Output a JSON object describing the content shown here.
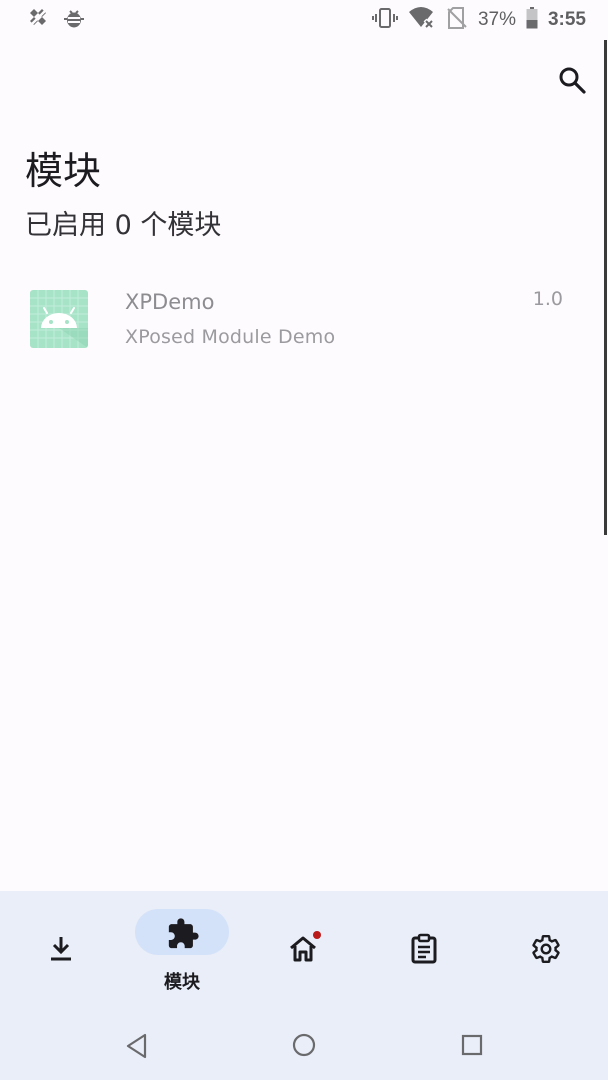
{
  "status_bar": {
    "battery_percent": "37%",
    "time": "3:55",
    "left_icons": [
      "no-cellular-data-icon",
      "bug-debug-icon"
    ],
    "right_icons": [
      "vibrate-icon",
      "wifi-off-icon",
      "no-sim-icon",
      "battery-icon"
    ]
  },
  "header": {
    "title": "模块",
    "subtitle": "已启用 0 个模块",
    "search_icon": "search-icon"
  },
  "modules": [
    {
      "name": "XPDemo",
      "description": "XPosed Module Demo",
      "version": "1.0",
      "icon": "android-app-icon"
    }
  ],
  "bottom_nav": {
    "items": [
      {
        "id": "repository",
        "icon": "download-icon",
        "label": ""
      },
      {
        "id": "modules",
        "icon": "puzzle-icon",
        "label": "模块",
        "selected": true
      },
      {
        "id": "home",
        "icon": "home-icon",
        "label": "",
        "badge": true
      },
      {
        "id": "logs",
        "icon": "clipboard-icon",
        "label": ""
      },
      {
        "id": "settings",
        "icon": "gear-icon",
        "label": ""
      }
    ]
  },
  "system_nav": {
    "buttons": [
      "back-icon",
      "home-circle-icon",
      "recents-icon"
    ]
  },
  "colors": {
    "background": "#fefbfe",
    "nav_background": "#e9eef8",
    "nav_pill": "#d4e2f9",
    "badge": "#ba1a1a",
    "icon_green": "#a6e3c7"
  }
}
